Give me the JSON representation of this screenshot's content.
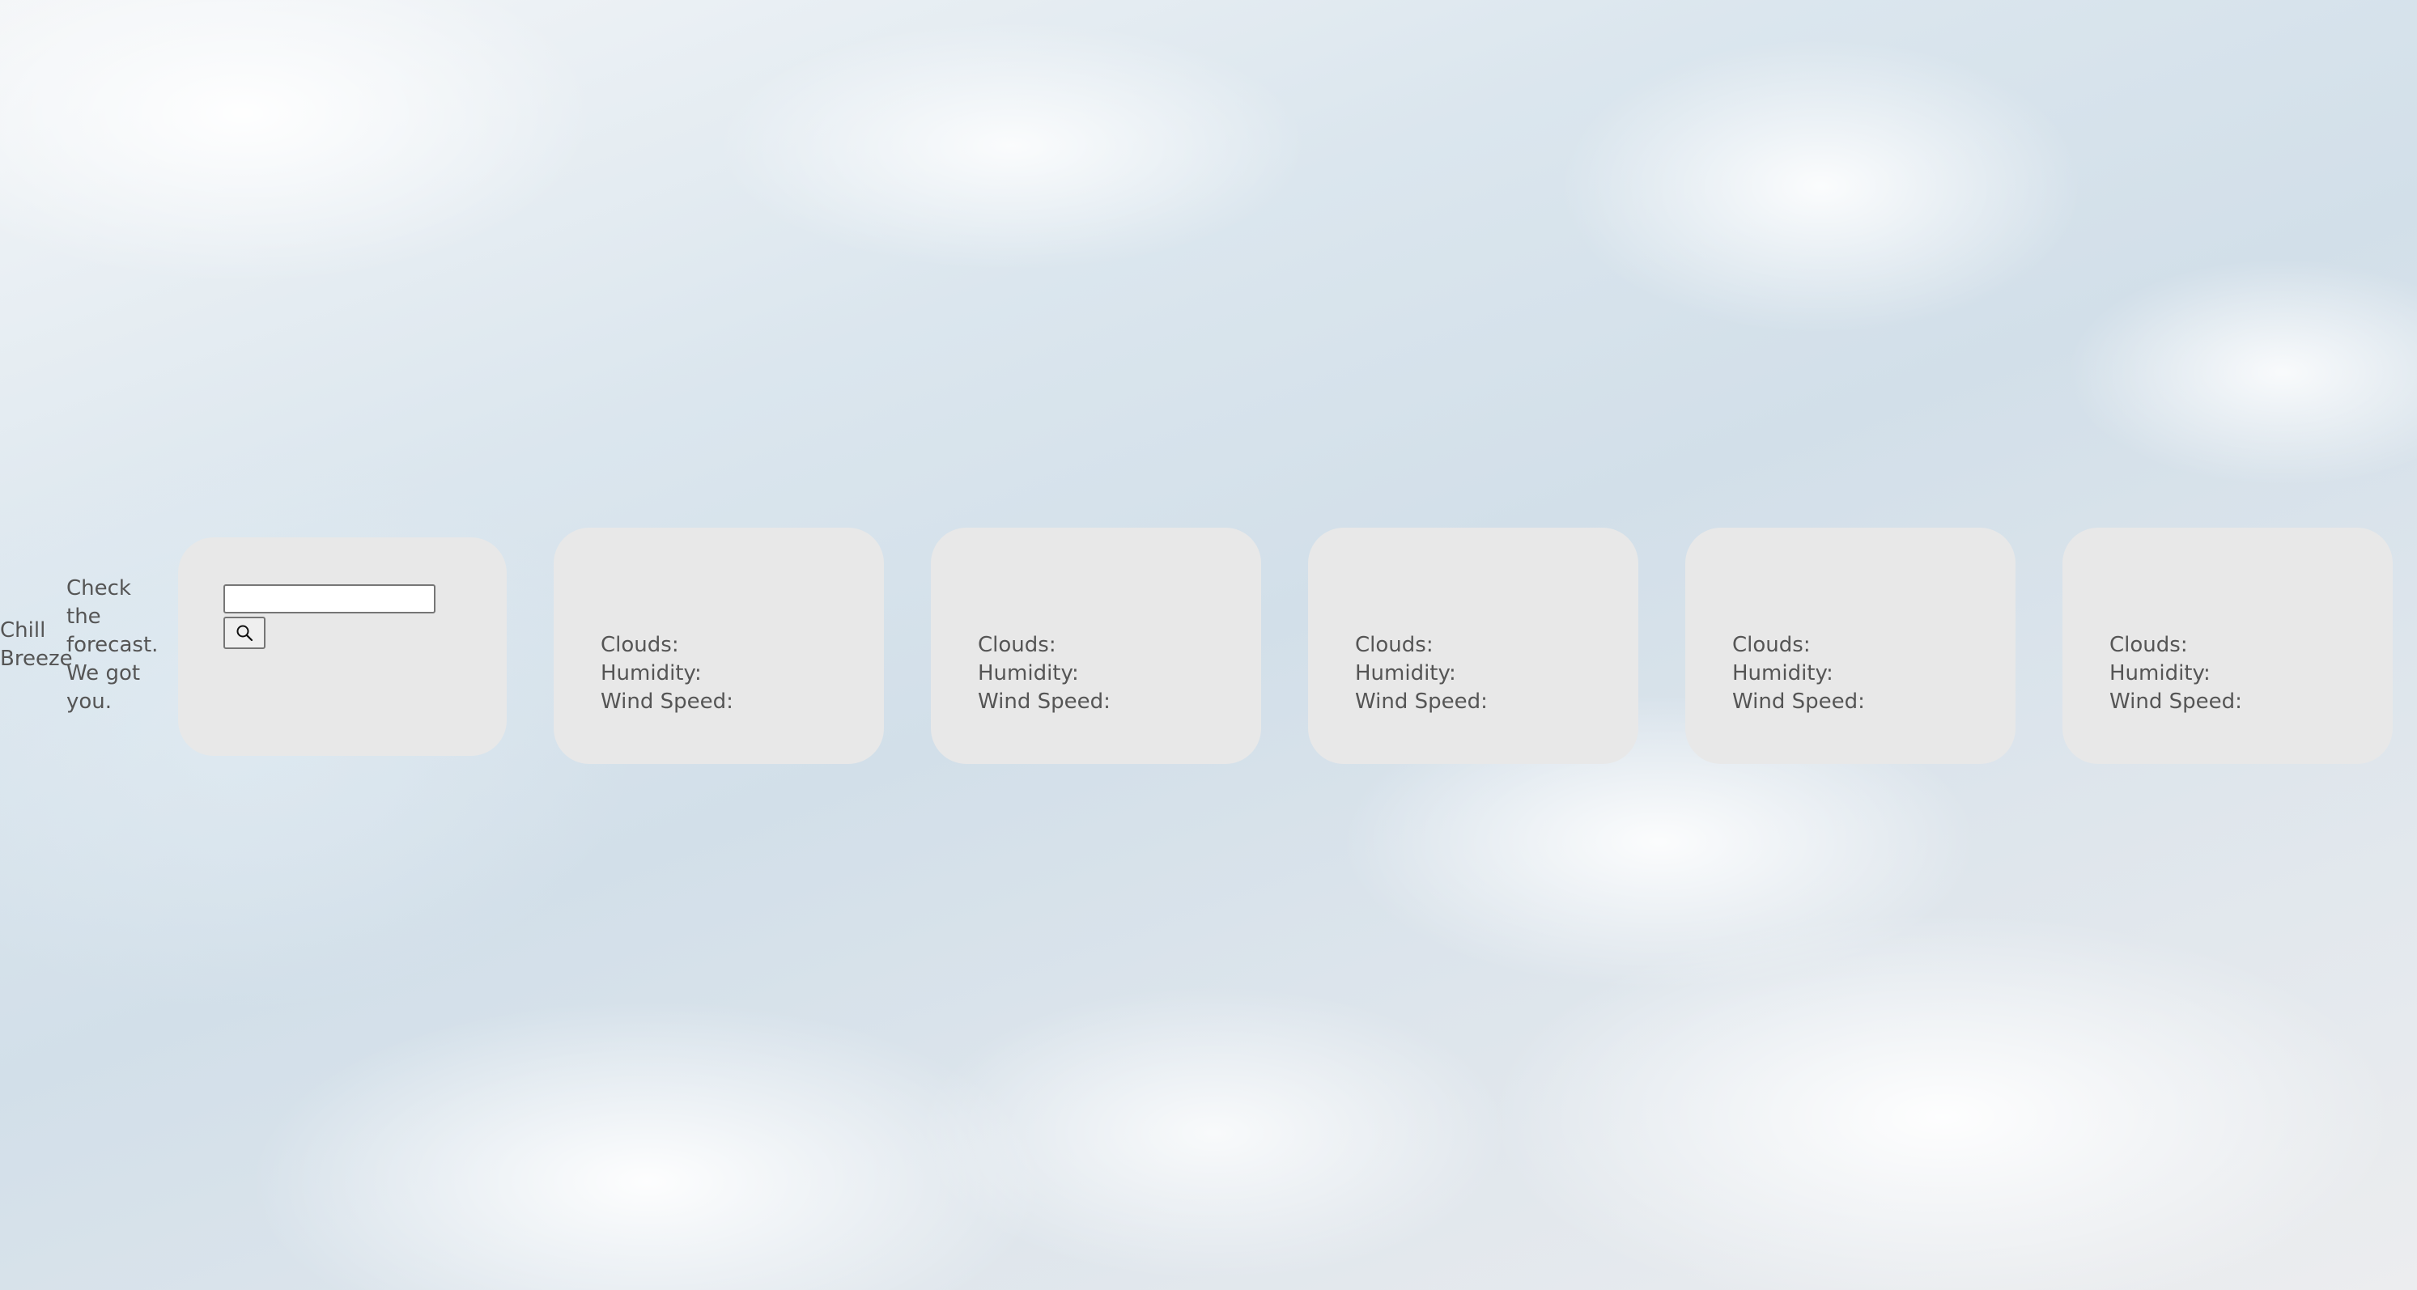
{
  "brand": {
    "name": "Chill Breeze",
    "tagline": "Check the forecast. We got you."
  },
  "search": {
    "value": "",
    "placeholder": "",
    "button_icon": "search-icon"
  },
  "forecast_cards": [
    {
      "clouds_label": "Clouds:",
      "humidity_label": "Humidity:",
      "wind_label": "Wind Speed:"
    },
    {
      "clouds_label": "Clouds:",
      "humidity_label": "Humidity:",
      "wind_label": "Wind Speed:"
    },
    {
      "clouds_label": "Clouds:",
      "humidity_label": "Humidity:",
      "wind_label": "Wind Speed:"
    },
    {
      "clouds_label": "Clouds:",
      "humidity_label": "Humidity:",
      "wind_label": "Wind Speed:"
    },
    {
      "clouds_label": "Clouds:",
      "humidity_label": "Humidity:",
      "wind_label": "Wind Speed:"
    }
  ],
  "colors": {
    "card_background": "#e8e8e8",
    "text": "#555555"
  }
}
